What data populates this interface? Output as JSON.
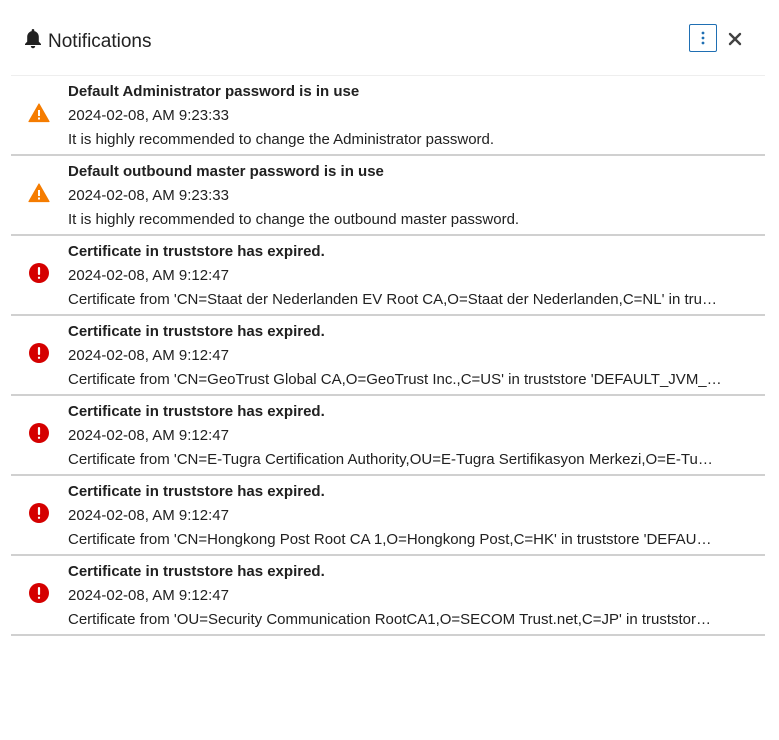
{
  "header": {
    "title": "Notifications",
    "bell_icon": "bell-icon",
    "menu_icon": "vertical-dots-icon",
    "close_icon": "close-icon"
  },
  "colors": {
    "warning": "#f57c00",
    "error": "#d50000",
    "menu_border": "#1f6fb3"
  },
  "notifications": [
    {
      "severity": "warning",
      "icon": "warning-triangle-icon",
      "title": "Default Administrator password is in use",
      "timestamp": "2024-02-08, AM 9:23:33",
      "message": "It is highly recommended to change the Administrator password."
    },
    {
      "severity": "warning",
      "icon": "warning-triangle-icon",
      "title": "Default outbound master password is in use",
      "timestamp": "2024-02-08, AM 9:23:33",
      "message": "It is highly recommended to change the outbound master password."
    },
    {
      "severity": "error",
      "icon": "error-circle-icon",
      "title": "Certificate in truststore has expired.",
      "timestamp": "2024-02-08, AM 9:12:47",
      "message": "Certificate from 'CN=Staat der Nederlanden EV Root CA,O=Staat der Nederlanden,C=NL' in tru…"
    },
    {
      "severity": "error",
      "icon": "error-circle-icon",
      "title": "Certificate in truststore has expired.",
      "timestamp": "2024-02-08, AM 9:12:47",
      "message": "Certificate from 'CN=GeoTrust Global CA,O=GeoTrust Inc.,C=US' in truststore 'DEFAULT_JVM_…"
    },
    {
      "severity": "error",
      "icon": "error-circle-icon",
      "title": "Certificate in truststore has expired.",
      "timestamp": "2024-02-08, AM 9:12:47",
      "message": "Certificate from 'CN=E-Tugra Certification Authority,OU=E-Tugra Sertifikasyon Merkezi,O=E-Tu…"
    },
    {
      "severity": "error",
      "icon": "error-circle-icon",
      "title": "Certificate in truststore has expired.",
      "timestamp": "2024-02-08, AM 9:12:47",
      "message": "Certificate from 'CN=Hongkong Post Root CA 1,O=Hongkong Post,C=HK' in truststore 'DEFAU…"
    },
    {
      "severity": "error",
      "icon": "error-circle-icon",
      "title": "Certificate in truststore has expired.",
      "timestamp": "2024-02-08, AM 9:12:47",
      "message": "Certificate from 'OU=Security Communication RootCA1,O=SECOM Trust.net,C=JP' in truststor…"
    }
  ]
}
